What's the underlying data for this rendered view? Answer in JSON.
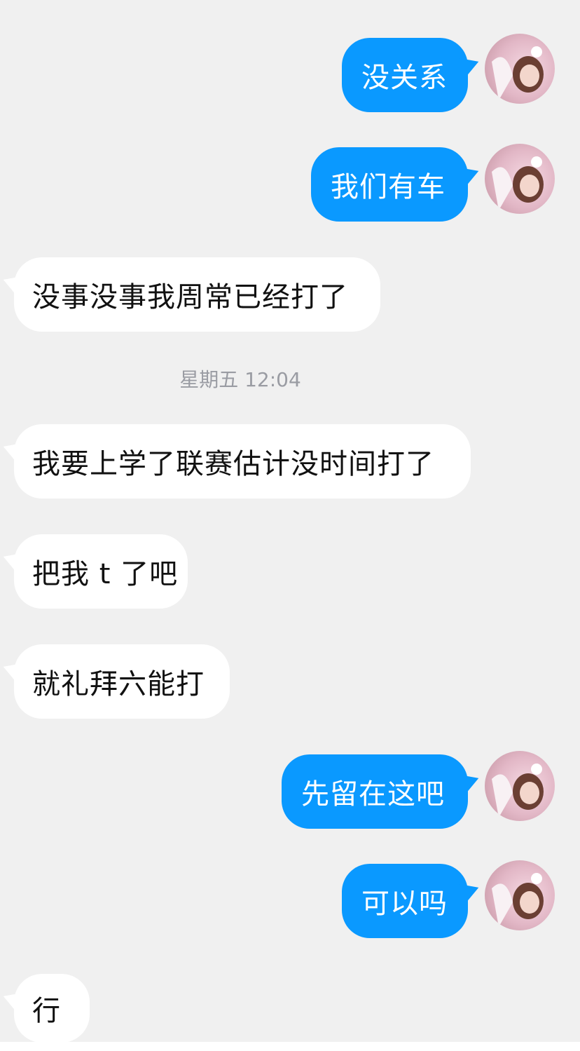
{
  "timestamp": "星期五 12:04",
  "messages": [
    {
      "side": "out",
      "text": "没关系"
    },
    {
      "side": "out",
      "text": "我们有车"
    },
    {
      "side": "in",
      "text": "没事没事我周常已经打了"
    },
    {
      "side": "in",
      "text": "我要上学了联赛估计没时间打了"
    },
    {
      "side": "in",
      "text": "把我 t 了吧"
    },
    {
      "side": "in",
      "text": "就礼拜六能打"
    },
    {
      "side": "out",
      "text": "先留在这吧"
    },
    {
      "side": "out",
      "text": "可以吗"
    },
    {
      "side": "in",
      "text": "行"
    }
  ],
  "colors": {
    "outgoing_bubble": "#0a99ff",
    "incoming_bubble": "#ffffff",
    "background": "#f0f0f0"
  }
}
